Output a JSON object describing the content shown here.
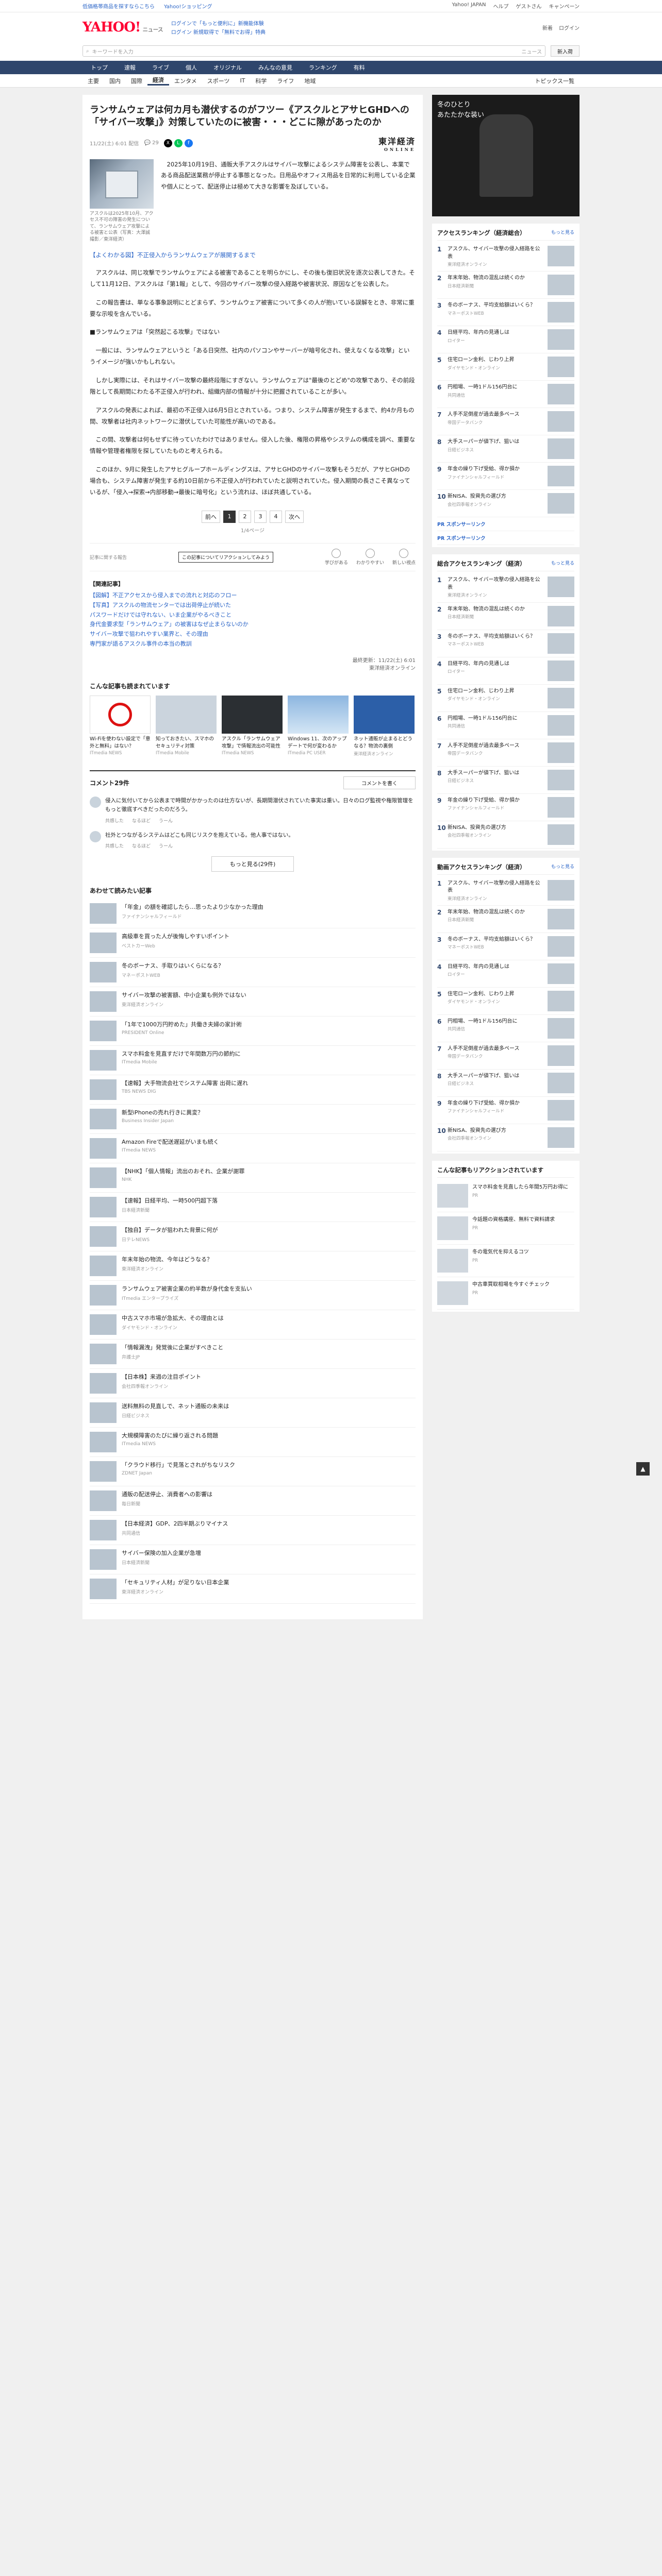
{
  "topbar": {
    "links": [
      "低価格帯商品を探すならこちら",
      "Yahoo!ショッピング"
    ],
    "right": [
      "Yahoo! JAPAN",
      "ヘルプ",
      "ゲストさん",
      "キャンペーン"
    ]
  },
  "header": {
    "logo": "YAHOO!",
    "logo_sub": "ニュース",
    "sub_links": [
      "ログインで「もっと便利に」新機能体験",
      "ログイン 新規取得で「無料でお得」特典"
    ],
    "right": [
      "新着",
      "ログイン"
    ]
  },
  "search": {
    "placeholder": "キーワードを入力",
    "scope": "ニュース",
    "login": "新入荷"
  },
  "nav_main": [
    "トップ",
    "速報",
    "ライブ",
    "個人",
    "オリジナル",
    "みんなの意見",
    "ランキング",
    "有料"
  ],
  "nav_sub": {
    "items": [
      "主要",
      "国内",
      "国際",
      "経済",
      "エンタメ",
      "スポーツ",
      "IT",
      "科学",
      "ライフ",
      "地域"
    ],
    "active": "経済",
    "right": "トピックス一覧"
  },
  "article": {
    "title": "ランサムウェアは何カ月も潜伏するのがフツー《アスクルとアサヒGHDへの「サイバー攻撃」》対策していたのに被害・・・どこに隙があったのか",
    "date": "11/22(土) 6:01 配信",
    "comments_count": "29",
    "publisher": "東洋経済",
    "publisher_sub": "ONLINE",
    "thumb_caption": "アスクルは2025年10月、アクセス不可の障害の発生について、ランサムウェア攻撃による被害と公表（写真：大澤誠撮影／東洋経済）",
    "paragraphs": [
      "2025年10月19日、通販大手アスクルはサイバー攻撃によるシステム障害を公表し、本業である商品配送業務が停止する事態となった。日用品やオフィス用品を日常的に利用している企業や個人にとって、配送停止は極めて大きな影響を及ぼしている。",
      "【よくわかる図】不正侵入からランサムウェアが展開するまで",
      "アスクルは、同じ攻撃でランサムウェアによる被害であることを明らかにし、その後も復旧状況を逐次公表してきた。そして11月12日、アスクルは「第1報」として、今回のサイバー攻撃の侵入経路や被害状況、原因などを公表した。",
      "この報告書は、単なる事象説明にとどまらず、ランサムウェア被害について多くの人が抱いている誤解をとき、非常に重要な示唆を含んでいる。",
      "■ランサムウェアは「突然起こる攻撃」ではない",
      "一般には、ランサムウェアというと「ある日突然、社内のパソコンやサーバーが暗号化され、使えなくなる攻撃」というイメージが強いかもしれない。",
      "しかし実際には、それはサイバー攻撃の最終段階にすぎない。ランサムウェアは\"最後のとどめ\"の攻撃であり、その前段階として長期間にわたる不正侵入が行われ、組織内部の情報が十分に把握されていることが多い。",
      "アスクルの発表によれば、最初の不正侵入は6月5日とされている。つまり、システム障害が発生するまで、約4か月もの間、攻撃者は社内ネットワークに潜伏していた可能性が高いのである。",
      "この間、攻撃者は何もせずに待っていたわけではありません。侵入した後、権限の昇格やシステムの構成を調べ、重要な情報や管理者権限を探していたものと考えられる。",
      "このほか、9月に発生したアサヒグループホールディングスは、アサヒGHDのサイバー攻撃もそうだが、アサヒGHDの場合も、システム障害が発生する約10日前から不正侵入が行われていたと説明されていた。侵入期間の長さこそ異なっているが、「侵入→探索→内部移動→最後に暗号化」という流れは、ほぼ共通している。"
    ],
    "pager": {
      "prev": "前へ",
      "pages": [
        "1",
        "2",
        "3",
        "4"
      ],
      "next": "次へ",
      "count": "1/4ページ"
    },
    "reactions": {
      "tooltip": "この記事についてリアクションしてみよう",
      "items": [
        "学びがある",
        "わかりやすい",
        "新しい視点"
      ],
      "note": "記事に関する報告"
    },
    "related": {
      "heading": "【関連記事】",
      "links": [
        "【図解】不正アクセスから侵入までの流れと対応のフロー",
        "【写真】アスクルの物流センターでは出荷停止が続いた",
        "パスワードだけでは守れない、いま企業がやるべきこと",
        "身代金要求型「ランサムウェア」の被害はなぜ止まらないのか",
        "サイバー攻撃で狙われやすい業界と、その理由",
        "専門家が語るアスクル事件の本当の教訓"
      ]
    },
    "credit": "最終更新：11/22(土) 6:01",
    "credit_pub": "東洋経済オンライン"
  },
  "popular": {
    "title": "こんな記事も読まれています",
    "cards": [
      {
        "t": "Wi-Fiを使わない設定で「意外と無料」はない？",
        "s": "ITmedia NEWS"
      },
      {
        "t": "知っておきたい、スマホのセキュリティ対策",
        "s": "ITmedia Mobile"
      },
      {
        "t": "アスクル「ランサムウェア攻撃」で情報流出の可能性",
        "s": "ITmedia NEWS"
      },
      {
        "t": "Windows 11、次のアップデートで何が変わるか",
        "s": "ITmedia PC USER"
      },
      {
        "t": "ネット通販が止まるとどうなる？物流の裏側",
        "s": "東洋経済オンライン"
      }
    ]
  },
  "comments": {
    "title": "コメント29件",
    "write": "コメントを書く",
    "items": [
      {
        "body": "侵入に気付いてから公表まで時間がかかったのは仕方ないが、長期間潜伏されていた事実は重い。日々のログ監視や権限管理をもっと徹底すべきだったのだろう。",
        "meta": [
          "共感した",
          "なるほど",
          "うーん"
        ]
      },
      {
        "body": "社外とつながるシステムはどこも同じリスクを抱えている。他人事ではない。",
        "meta": [
          "共感した",
          "なるほど",
          "うーん"
        ]
      }
    ],
    "more": "もっと見る(29件)"
  },
  "recommend": {
    "title": "あわせて読みたい記事",
    "items": [
      {
        "t": "「年金」の額を確認したら…思ったより少なかった理由",
        "s": "ファイナンシャルフィールド"
      },
      {
        "t": "高級車を買った人が後悔しやすいポイント",
        "s": "ベストカーWeb"
      },
      {
        "t": "冬のボーナス、手取りはいくらになる？",
        "s": "マネーポストWEB"
      },
      {
        "t": "サイバー攻撃の被害額、中小企業も例外ではない",
        "s": "東洋経済オンライン"
      },
      {
        "t": "「1年で1000万円貯めた」共働き夫婦の家計術",
        "s": "PRESIDENT Online"
      },
      {
        "t": "スマホ料金を見直すだけで年間数万円の節約に",
        "s": "ITmedia Mobile"
      },
      {
        "t": "【速報】大手物流会社でシステム障害 出荷に遅れ",
        "s": "TBS NEWS DIG"
      },
      {
        "t": "新型iPhoneの売れ行きに異変？",
        "s": "Business Insider Japan"
      },
      {
        "t": "Amazon Fireで配送遅延がいまも続く",
        "s": "ITmedia NEWS"
      },
      {
        "t": "【NHK】「個人情報」流出のおそれ、企業が謝罪",
        "s": "NHK"
      },
      {
        "t": "【速報】日経平均、一時500円超下落",
        "s": "日本経済新聞"
      },
      {
        "t": "【独自】データが狙われた背景に何が",
        "s": "日テレNEWS"
      },
      {
        "t": "年末年始の物流、今年はどうなる？",
        "s": "東洋経済オンライン"
      },
      {
        "t": "ランサムウェア被害企業の約半数が身代金を支払い",
        "s": "ITmedia エンタープライズ"
      },
      {
        "t": "中古スマホ市場が急拡大、その理由とは",
        "s": "ダイヤモンド・オンライン"
      },
      {
        "t": "「情報漏洩」発覚後に企業がすべきこと",
        "s": "弁護士JP"
      },
      {
        "t": "【日本株】来週の注目ポイント",
        "s": "会社四季報オンライン"
      },
      {
        "t": "送料無料の見直しで、ネット通販の未来は",
        "s": "日経ビジネス"
      },
      {
        "t": "大規模障害のたびに繰り返される問題",
        "s": "ITmedia NEWS"
      },
      {
        "t": "「クラウド移行」で見落とされがちなリスク",
        "s": "ZDNET Japan"
      },
      {
        "t": "通販の配送停止、消費者への影響は",
        "s": "毎日新聞"
      },
      {
        "t": "【日本経済】GDP、2四半期ぶりマイナス",
        "s": "共同通信"
      },
      {
        "t": "サイバー保険の加入企業が急増",
        "s": "日本経済新聞"
      },
      {
        "t": "「セキュリティ人材」が足りない日本企業",
        "s": "東洋経済オンライン"
      }
    ]
  },
  "side": {
    "ad_text": [
      "冬のひとり",
      "あたたかな装い"
    ],
    "ranking_title": "アクセスランキング（経済総合）",
    "ranking_more": "もっと見る",
    "ranking": [
      {
        "t": "アスクル、サイバー攻撃の侵入経路を公表",
        "s": "東洋経済オンライン"
      },
      {
        "t": "年末年始、物流の混乱は続くのか",
        "s": "日本経済新聞"
      },
      {
        "t": "冬のボーナス、平均支給額はいくら？",
        "s": "マネーポストWEB"
      },
      {
        "t": "日経平均、年内の見通しは",
        "s": "ロイター"
      },
      {
        "t": "住宅ローン金利、じわり上昇",
        "s": "ダイヤモンド・オンライン"
      },
      {
        "t": "円相場、一時1ドル156円台に",
        "s": "共同通信"
      },
      {
        "t": "人手不足倒産が過去最多ペース",
        "s": "帝国データバンク"
      },
      {
        "t": "大手スーパーが値下げ、狙いは",
        "s": "日経ビジネス"
      },
      {
        "t": "年金の繰り下げ受給、得か損か",
        "s": "ファイナンシャルフィールド"
      },
      {
        "t": "新NISA、投資先の選び方",
        "s": "会社四季報オンライン"
      }
    ],
    "sponsors": [
      "PR スポンサーリンク",
      "PR スポンサーリンク"
    ],
    "ranking2_title": "総合アクセスランキング（経済）",
    "ranking3_title": "動画アクセスランキング（経済）",
    "ads_title": "こんな記事もリアクションされています",
    "ads": [
      {
        "t": "スマホ料金を見直したら年間5万円お得に",
        "pr": "PR"
      },
      {
        "t": "今話題の資格講座、無料で資料請求",
        "pr": "PR"
      },
      {
        "t": "冬の電気代を抑えるコツ",
        "pr": "PR"
      },
      {
        "t": "中古車買取相場を今すぐチェック",
        "pr": "PR"
      }
    ]
  },
  "colors": {
    "nav": "#2f466c",
    "brand": "#ff0033",
    "link": "#2a64c7"
  }
}
